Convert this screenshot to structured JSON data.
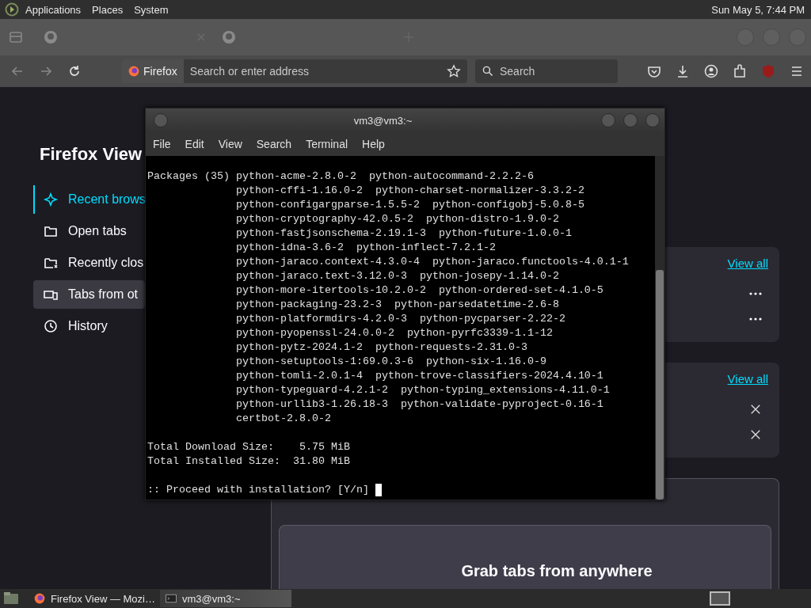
{
  "top_panel": {
    "menus": [
      "Applications",
      "Places",
      "System"
    ],
    "clock": "Sun May 5, 7:44 PM"
  },
  "browser": {
    "urlbar": {
      "identity": "Firefox",
      "placeholder": "Search or enter address"
    },
    "search": {
      "placeholder": "Search"
    },
    "page": {
      "title": "Firefox View",
      "nav": [
        {
          "kind": "recent",
          "label": "Recent brows",
          "selected": true,
          "hovered": false
        },
        {
          "kind": "open",
          "label": "Open tabs",
          "selected": false,
          "hovered": false
        },
        {
          "kind": "closed",
          "label": "Recently clos",
          "selected": false,
          "hovered": false
        },
        {
          "kind": "devices",
          "label": "Tabs from ot",
          "selected": false,
          "hovered": true
        },
        {
          "kind": "history",
          "label": "History",
          "selected": false,
          "hovered": false
        }
      ],
      "cards": [
        {
          "link": "View all",
          "rows": [
            {
              "kind": "more"
            },
            {
              "kind": "more"
            }
          ]
        },
        {
          "link": "View all",
          "rows": [
            {
              "kind": "close"
            },
            {
              "kind": "close"
            }
          ]
        }
      ],
      "devices_card": {
        "heading": "Grab tabs from anywhere"
      }
    }
  },
  "terminal": {
    "title": "vm3@vm3:~",
    "menus": [
      "File",
      "Edit",
      "View",
      "Search",
      "Terminal",
      "Help"
    ],
    "package_lines": [
      "Packages (35) python-acme-2.8.0-2  python-autocommand-2.2.2-6",
      "              python-cffi-1.16.0-2  python-charset-normalizer-3.3.2-2",
      "              python-configargparse-1.5.5-2  python-configobj-5.0.8-5",
      "              python-cryptography-42.0.5-2  python-distro-1.9.0-2",
      "              python-fastjsonschema-2.19.1-3  python-future-1.0.0-1",
      "              python-idna-3.6-2  python-inflect-7.2.1-2",
      "              python-jaraco.context-4.3.0-4  python-jaraco.functools-4.0.1-1",
      "              python-jaraco.text-3.12.0-3  python-josepy-1.14.0-2",
      "              python-more-itertools-10.2.0-2  python-ordered-set-4.1.0-5",
      "              python-packaging-23.2-3  python-parsedatetime-2.6-8",
      "              python-platformdirs-4.2.0-3  python-pycparser-2.22-2",
      "              python-pyopenssl-24.0.0-2  python-pyrfc3339-1.1-12",
      "              python-pytz-2024.1-2  python-requests-2.31.0-3",
      "              python-setuptools-1:69.0.3-6  python-six-1.16.0-9",
      "              python-tomli-2.0.1-4  python-trove-classifiers-2024.4.10-1",
      "              python-typeguard-4.2.1-2  python-typing_extensions-4.11.0-1",
      "              python-urllib3-1.26.18-3  python-validate-pyproject-0.16-1",
      "              certbot-2.8.0-2"
    ],
    "totals": [
      "Total Download Size:    5.75 MiB",
      "Total Installed Size:  31.80 MiB"
    ],
    "prompt": ":: Proceed with installation? [Y/n]"
  },
  "taskbar": {
    "tasks": [
      {
        "kind": "browser",
        "label": "Firefox View — Mozi…",
        "selected": false
      },
      {
        "kind": "terminal",
        "label": "vm3@vm3:~",
        "selected": true
      }
    ]
  }
}
